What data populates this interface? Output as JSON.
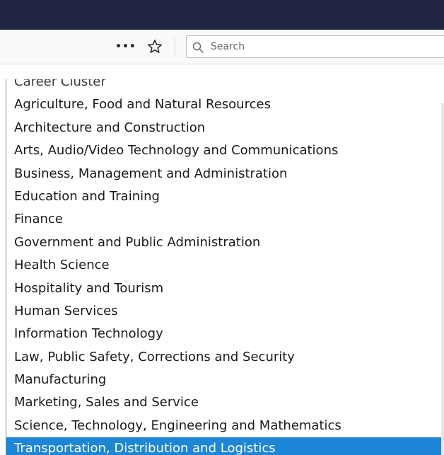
{
  "toolbar": {
    "more_icon": "ellipsis-icon",
    "more_label": "•••",
    "bookmark_icon": "star-icon",
    "search": {
      "placeholder": "Search",
      "value": "",
      "icon": "search-icon"
    }
  },
  "dropdown": {
    "header": "Career Cluster",
    "selected_index": 16,
    "selected_color": "#1e86d6",
    "options": [
      "Agriculture, Food and Natural Resources",
      "Architecture and Construction",
      "Arts, Audio/Video Technology and Communications",
      "Business, Management and Administration",
      "Education and Training",
      "Finance",
      "Government and Public Administration",
      "Health Science",
      "Hospitality and Tourism",
      "Human Services",
      "Information Technology",
      "Law, Public Safety, Corrections and Security",
      "Manufacturing",
      "Marketing, Sales and Service",
      "Science, Technology, Engineering and Mathematics",
      "Transportation, Distribution and Logistics"
    ]
  },
  "colors": {
    "titlebar": "#1f2442",
    "toolbar": "#f9f9fa",
    "highlight": "#1e86d6"
  }
}
